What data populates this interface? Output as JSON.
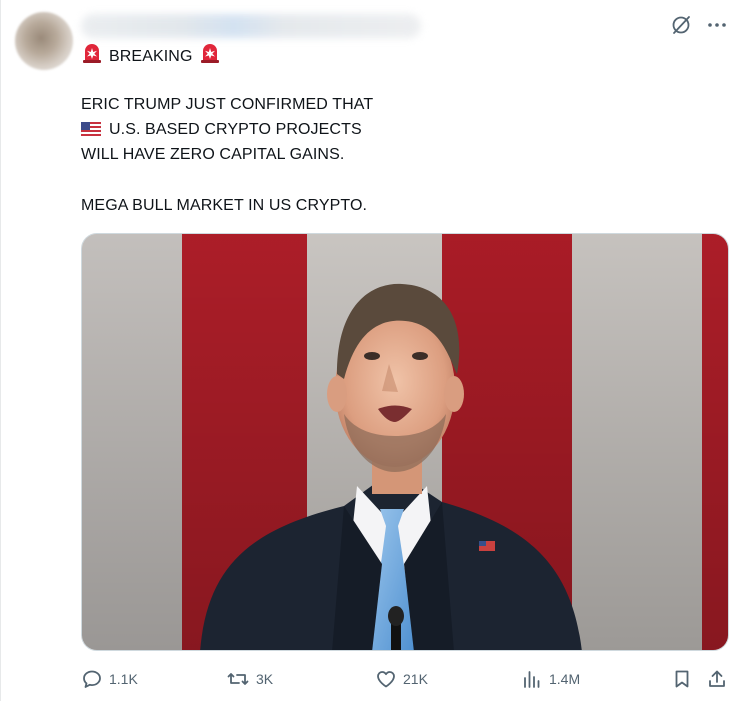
{
  "post": {
    "breaking": "BREAKING",
    "line1": "ERIC TRUMP JUST CONFIRMED THAT",
    "line2": "U.S. BASED CRYPTO PROJECTS",
    "line3": "WILL HAVE ZERO CAPITAL GAINS.",
    "line4": "MEGA BULL MARKET IN US CRYPTO."
  },
  "actions": {
    "replies": "1.1K",
    "reposts": "3K",
    "likes": "21K",
    "views": "1.4M"
  },
  "icons": {
    "grok": "grok-icon",
    "more": "more-icon",
    "siren": "siren-emoji-icon",
    "flag": "us-flag-emoji-icon",
    "reply": "reply-icon",
    "repost": "repost-icon",
    "like": "heart-icon",
    "views": "views-icon",
    "bookmark": "bookmark-icon",
    "share": "share-icon"
  },
  "colors": {
    "text": "#0f1419",
    "muted": "#536471",
    "siren_red": "#e0263a"
  }
}
